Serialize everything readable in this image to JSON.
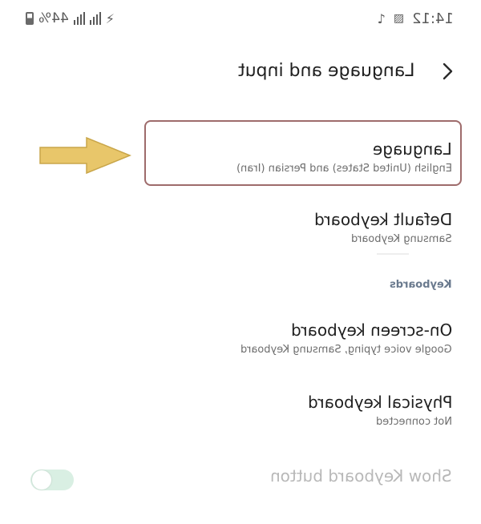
{
  "status_bar": {
    "battery": "44%",
    "time": "14:12"
  },
  "header": {
    "title": "Language and input"
  },
  "items": [
    {
      "title": "Language",
      "subtitle": "English (United States) and Persian (Iran)"
    },
    {
      "title": "Default keyboard",
      "subtitle": "Samsung Keyboard"
    }
  ],
  "section": {
    "keyboards_label": "Keyboards"
  },
  "keyboard_items": [
    {
      "title": "On-screen keyboard",
      "subtitle": "Google voice typing, Samsung Keyboard"
    },
    {
      "title": "Physical keyboard",
      "subtitle": "Not connected"
    }
  ],
  "show_keyboard_button": {
    "title": "Show Keyboard button",
    "enabled": false
  },
  "colors": {
    "highlight_border": "#9e6b6b",
    "arrow_fill": "#e8c66a",
    "toggle_track": "#d9efe3"
  }
}
